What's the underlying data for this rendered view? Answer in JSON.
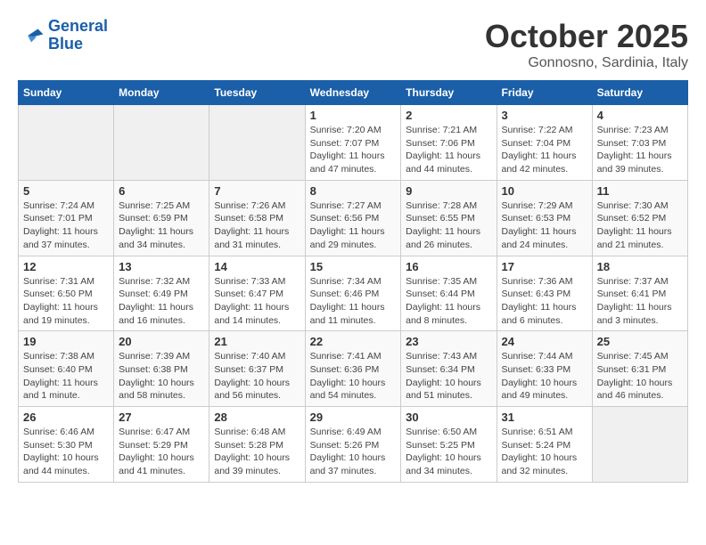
{
  "logo": {
    "line1": "General",
    "line2": "Blue"
  },
  "title": "October 2025",
  "subtitle": "Gonnosno, Sardinia, Italy",
  "weekdays": [
    "Sunday",
    "Monday",
    "Tuesday",
    "Wednesday",
    "Thursday",
    "Friday",
    "Saturday"
  ],
  "weeks": [
    [
      {
        "day": "",
        "info": ""
      },
      {
        "day": "",
        "info": ""
      },
      {
        "day": "",
        "info": ""
      },
      {
        "day": "1",
        "info": "Sunrise: 7:20 AM\nSunset: 7:07 PM\nDaylight: 11 hours\nand 47 minutes."
      },
      {
        "day": "2",
        "info": "Sunrise: 7:21 AM\nSunset: 7:06 PM\nDaylight: 11 hours\nand 44 minutes."
      },
      {
        "day": "3",
        "info": "Sunrise: 7:22 AM\nSunset: 7:04 PM\nDaylight: 11 hours\nand 42 minutes."
      },
      {
        "day": "4",
        "info": "Sunrise: 7:23 AM\nSunset: 7:03 PM\nDaylight: 11 hours\nand 39 minutes."
      }
    ],
    [
      {
        "day": "5",
        "info": "Sunrise: 7:24 AM\nSunset: 7:01 PM\nDaylight: 11 hours\nand 37 minutes."
      },
      {
        "day": "6",
        "info": "Sunrise: 7:25 AM\nSunset: 6:59 PM\nDaylight: 11 hours\nand 34 minutes."
      },
      {
        "day": "7",
        "info": "Sunrise: 7:26 AM\nSunset: 6:58 PM\nDaylight: 11 hours\nand 31 minutes."
      },
      {
        "day": "8",
        "info": "Sunrise: 7:27 AM\nSunset: 6:56 PM\nDaylight: 11 hours\nand 29 minutes."
      },
      {
        "day": "9",
        "info": "Sunrise: 7:28 AM\nSunset: 6:55 PM\nDaylight: 11 hours\nand 26 minutes."
      },
      {
        "day": "10",
        "info": "Sunrise: 7:29 AM\nSunset: 6:53 PM\nDaylight: 11 hours\nand 24 minutes."
      },
      {
        "day": "11",
        "info": "Sunrise: 7:30 AM\nSunset: 6:52 PM\nDaylight: 11 hours\nand 21 minutes."
      }
    ],
    [
      {
        "day": "12",
        "info": "Sunrise: 7:31 AM\nSunset: 6:50 PM\nDaylight: 11 hours\nand 19 minutes."
      },
      {
        "day": "13",
        "info": "Sunrise: 7:32 AM\nSunset: 6:49 PM\nDaylight: 11 hours\nand 16 minutes."
      },
      {
        "day": "14",
        "info": "Sunrise: 7:33 AM\nSunset: 6:47 PM\nDaylight: 11 hours\nand 14 minutes."
      },
      {
        "day": "15",
        "info": "Sunrise: 7:34 AM\nSunset: 6:46 PM\nDaylight: 11 hours\nand 11 minutes."
      },
      {
        "day": "16",
        "info": "Sunrise: 7:35 AM\nSunset: 6:44 PM\nDaylight: 11 hours\nand 8 minutes."
      },
      {
        "day": "17",
        "info": "Sunrise: 7:36 AM\nSunset: 6:43 PM\nDaylight: 11 hours\nand 6 minutes."
      },
      {
        "day": "18",
        "info": "Sunrise: 7:37 AM\nSunset: 6:41 PM\nDaylight: 11 hours\nand 3 minutes."
      }
    ],
    [
      {
        "day": "19",
        "info": "Sunrise: 7:38 AM\nSunset: 6:40 PM\nDaylight: 11 hours\nand 1 minute."
      },
      {
        "day": "20",
        "info": "Sunrise: 7:39 AM\nSunset: 6:38 PM\nDaylight: 10 hours\nand 58 minutes."
      },
      {
        "day": "21",
        "info": "Sunrise: 7:40 AM\nSunset: 6:37 PM\nDaylight: 10 hours\nand 56 minutes."
      },
      {
        "day": "22",
        "info": "Sunrise: 7:41 AM\nSunset: 6:36 PM\nDaylight: 10 hours\nand 54 minutes."
      },
      {
        "day": "23",
        "info": "Sunrise: 7:43 AM\nSunset: 6:34 PM\nDaylight: 10 hours\nand 51 minutes."
      },
      {
        "day": "24",
        "info": "Sunrise: 7:44 AM\nSunset: 6:33 PM\nDaylight: 10 hours\nand 49 minutes."
      },
      {
        "day": "25",
        "info": "Sunrise: 7:45 AM\nSunset: 6:31 PM\nDaylight: 10 hours\nand 46 minutes."
      }
    ],
    [
      {
        "day": "26",
        "info": "Sunrise: 6:46 AM\nSunset: 5:30 PM\nDaylight: 10 hours\nand 44 minutes."
      },
      {
        "day": "27",
        "info": "Sunrise: 6:47 AM\nSunset: 5:29 PM\nDaylight: 10 hours\nand 41 minutes."
      },
      {
        "day": "28",
        "info": "Sunrise: 6:48 AM\nSunset: 5:28 PM\nDaylight: 10 hours\nand 39 minutes."
      },
      {
        "day": "29",
        "info": "Sunrise: 6:49 AM\nSunset: 5:26 PM\nDaylight: 10 hours\nand 37 minutes."
      },
      {
        "day": "30",
        "info": "Sunrise: 6:50 AM\nSunset: 5:25 PM\nDaylight: 10 hours\nand 34 minutes."
      },
      {
        "day": "31",
        "info": "Sunrise: 6:51 AM\nSunset: 5:24 PM\nDaylight: 10 hours\nand 32 minutes."
      },
      {
        "day": "",
        "info": ""
      }
    ]
  ]
}
